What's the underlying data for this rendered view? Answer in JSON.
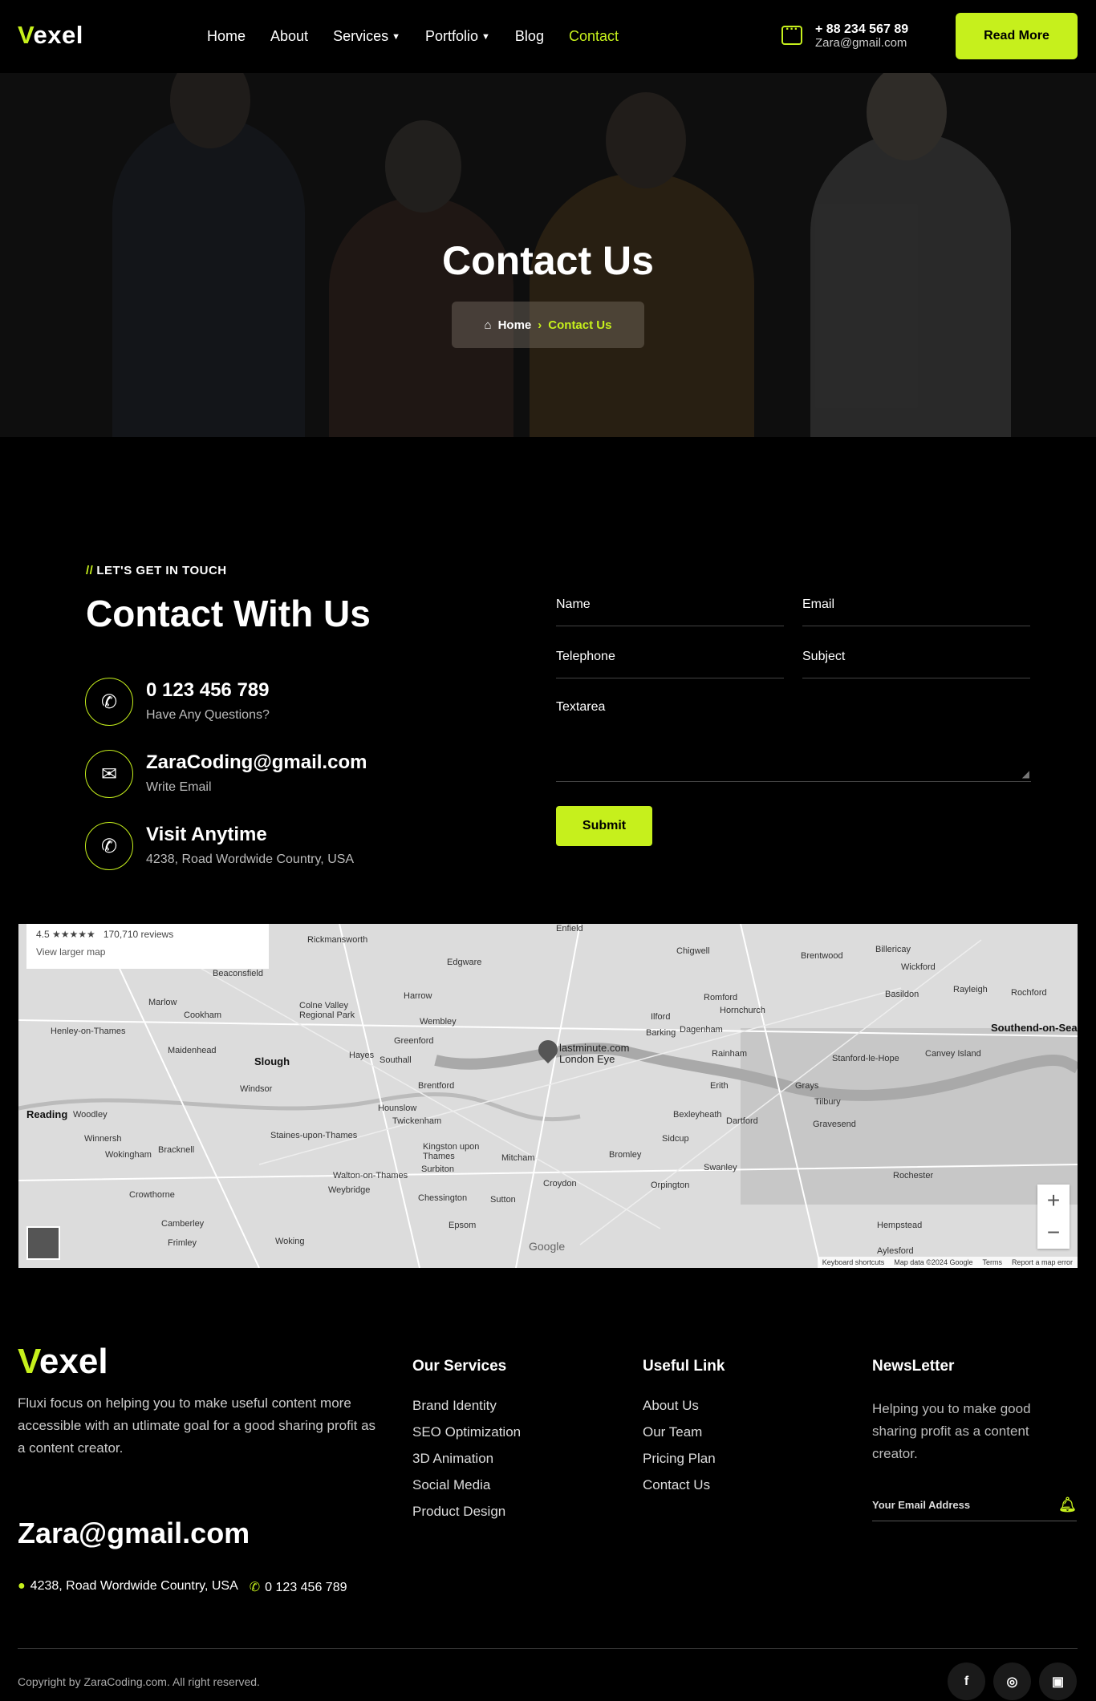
{
  "header": {
    "logo_accent": "V",
    "logo_rest": "exel",
    "nav": [
      {
        "label": "Home"
      },
      {
        "label": "About"
      },
      {
        "label": "Services"
      },
      {
        "label": "Portfolio"
      },
      {
        "label": "Blog"
      },
      {
        "label": "Contact"
      }
    ],
    "phone": "+ 88 234 567 89",
    "email": "Zara@gmail.com",
    "button": "Read More"
  },
  "hero": {
    "title": "Contact Us",
    "breadcrumb_home": "Home",
    "breadcrumb_current": "Contact Us"
  },
  "contact": {
    "kicker_slashes": "//",
    "kicker": "LET'S GET IN TOUCH",
    "title": "Contact With Us",
    "items": [
      {
        "main": "0 123 456 789",
        "sub": "Have Any Questions?"
      },
      {
        "main": "ZaraCoding@gmail.com",
        "sub": "Write Email"
      },
      {
        "main": "Visit Anytime",
        "sub": "4238, Road Wordwide Country, USA"
      }
    ],
    "form": {
      "name": "Name",
      "email": "Email",
      "telephone": "Telephone",
      "subject": "Subject",
      "textarea": "Textarea",
      "submit": "Submit"
    }
  },
  "map": {
    "rating": "4.5 ★★★★★",
    "reviews": "170,710 reviews",
    "larger_map": "View larger map",
    "pin_label_1": "lastminute.com",
    "pin_label_2": "London Eye",
    "google": "Google",
    "footer_shortcuts": "Keyboard shortcuts",
    "footer_data": "Map data ©2024 Google",
    "footer_terms": "Terms",
    "footer_report": "Report a map error",
    "labels": {
      "rickmansworth": "Rickmansworth",
      "enfield": "Enfield",
      "chigwell": "Chigwell",
      "brentwood": "Brentwood",
      "billericay": "Billericay",
      "wickford": "Wickford",
      "rayleigh": "Rayleigh",
      "rochford": "Rochford",
      "southend": "Southend-on-Sea",
      "edgware": "Edgware",
      "harrow": "Harrow",
      "romford": "Romford",
      "hornchurch": "Hornchurch",
      "basildon": "Basildon",
      "beaconsfield": "Beaconsfield",
      "marlow": "Marlow",
      "cookham": "Cookham",
      "colne": "Colne Valley Regional Park",
      "wembley": "Wembley",
      "ilford": "Ilford",
      "barking": "Barking",
      "dagenham": "Dagenham",
      "stanford": "Stanford-le-Hope",
      "canvey": "Canvey Island",
      "henley": "Henley-on-Thames",
      "maidenhead": "Maidenhead",
      "slough": "Slough",
      "hayes": "Hayes",
      "southall": "Southall",
      "greenford": "Greenford",
      "rainham": "Rainham",
      "windsor": "Windsor",
      "brentford": "Brentford",
      "erith": "Erith",
      "grays": "Grays",
      "tilbury": "Tilbury",
      "reading": "Reading",
      "woodley": "Woodley",
      "hounslow": "Hounslow",
      "twickenham": "Twickenham",
      "bexleyheath": "Bexleyheath",
      "dartford": "Dartford",
      "gravesend": "Gravesend",
      "wokingham": "Wokingham",
      "winnersh": "Winnersh",
      "bracknell": "Bracknell",
      "staines": "Staines-upon-Thames",
      "kingston": "Kingston upon Thames",
      "surbiton": "Surbiton",
      "mitcham": "Mitcham",
      "bromley": "Bromley",
      "sidcup": "Sidcup",
      "swanley": "Swanley",
      "rochester": "Rochester",
      "walton": "Walton-on-Thames",
      "weybridge": "Weybridge",
      "croydon": "Croydon",
      "orpington": "Orpington",
      "crowthorne": "Crowthorne",
      "chessington": "Chessington",
      "sutton": "Sutton",
      "camberley": "Camberley",
      "frimley": "Frimley",
      "woking": "Woking",
      "epsom": "Epsom",
      "aylesford": "Aylesford",
      "hempstead": "Hempstead"
    }
  },
  "footer": {
    "logo_accent": "V",
    "logo_rest": "exel",
    "description": "Fluxi focus on helping you to make useful content more accessible with an utlimate goal for a good sharing profit as a content creator.",
    "email": "Zara@gmail.com",
    "address": "4238, Road Wordwide Country, USA",
    "phone": "0 123 456 789",
    "services_title": "Our Services",
    "services": [
      "Brand Identity",
      "SEO Optimization",
      "3D Animation",
      "Social Media",
      "Product Design"
    ],
    "links_title": "Useful Link",
    "links": [
      "About Us",
      "Our Team",
      "Pricing Plan",
      "Contact Us"
    ],
    "newsletter_title": "NewsLetter",
    "newsletter_text": "Helping you to make  good sharing profit as a content creator.",
    "newsletter_placeholder": "Your Email Address",
    "copyright": "Copyright by ZaraCoding.com. All right reserved."
  },
  "colors": {
    "accent": "#c6f01c",
    "background": "#000000"
  }
}
